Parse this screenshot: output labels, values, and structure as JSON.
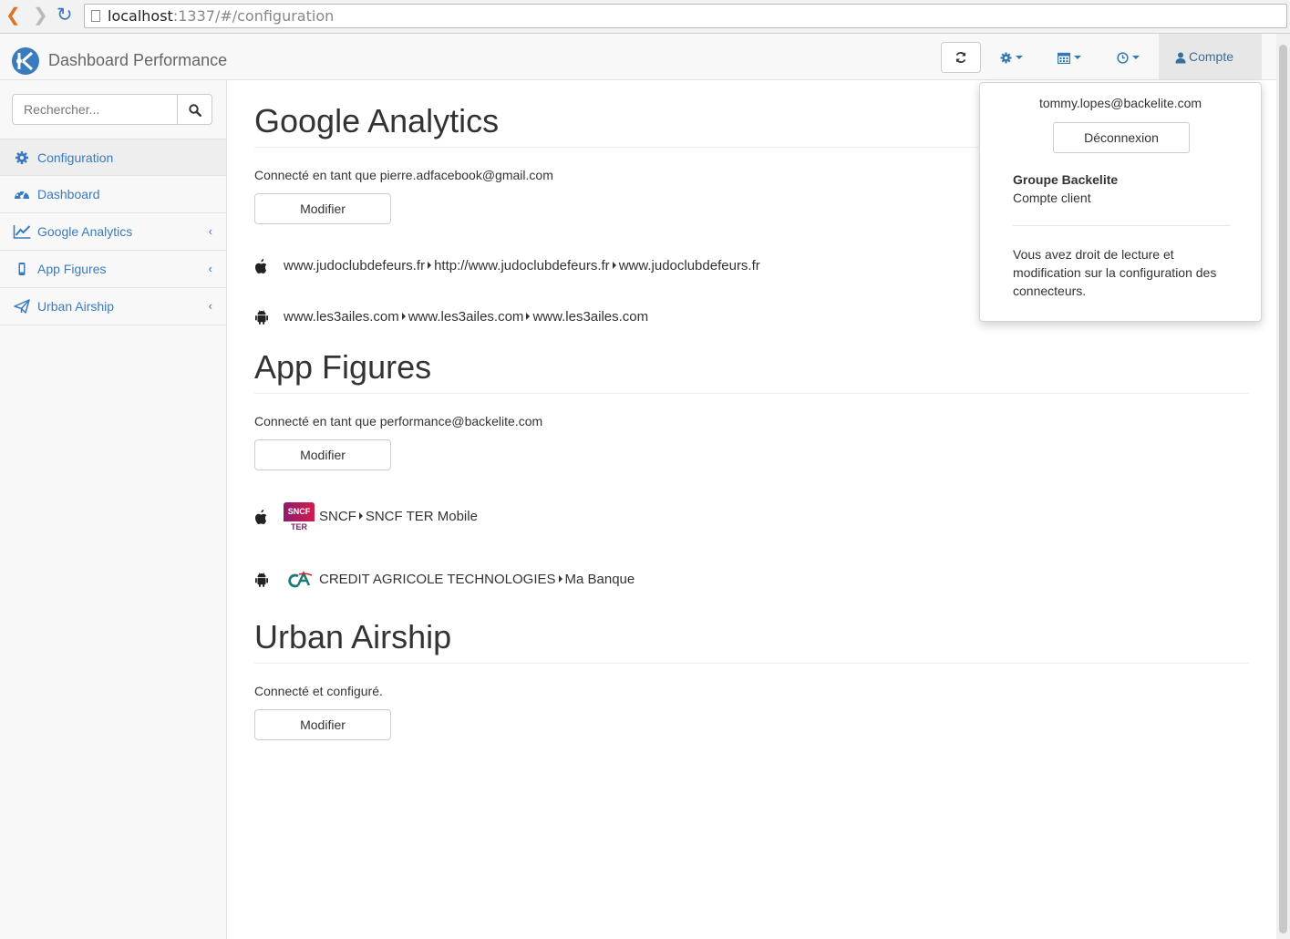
{
  "browser": {
    "url_host": "localhost",
    "url_path": ":1337/#/configuration"
  },
  "navbar": {
    "brand": "Dashboard Performance",
    "account_label": "Compte"
  },
  "sidebar": {
    "search_placeholder": "Rechercher...",
    "items": [
      {
        "label": "Configuration",
        "icon": "gear-icon",
        "active": true
      },
      {
        "label": "Dashboard",
        "icon": "dashboard-icon"
      },
      {
        "label": "Google Analytics",
        "icon": "line-chart-icon"
      },
      {
        "label": "App Figures",
        "icon": "mobile-icon"
      },
      {
        "label": "Urban Airship",
        "icon": "paper-plane-icon"
      }
    ]
  },
  "sections": {
    "google_analytics": {
      "title": "Google Analytics",
      "connected": "Connecté en tant que pierre.adfacebook@gmail.com",
      "button": "Modifier",
      "rows": [
        {
          "os": "apple",
          "parts": [
            "www.judoclubdefeurs.fr",
            "http://www.judoclubdefeurs.fr",
            "www.judoclubdefeurs.fr"
          ]
        },
        {
          "os": "android",
          "parts": [
            "www.les3ailes.com",
            "www.les3ailes.com",
            "www.les3ailes.com"
          ]
        }
      ]
    },
    "app_figures": {
      "title": "App Figures",
      "connected": "Connecté en tant que performance@backelite.com",
      "button": "Modifier",
      "rows": [
        {
          "os": "apple",
          "logo_top": "SNCF",
          "logo_bottom": "TER",
          "parts": [
            "SNCF",
            "SNCF TER Mobile"
          ]
        },
        {
          "os": "android",
          "logo": "CA",
          "parts": [
            "CREDIT AGRICOLE TECHNOLOGIES",
            "Ma Banque"
          ]
        }
      ]
    },
    "urban_airship": {
      "title": "Urban Airship",
      "connected": "Connecté et configuré.",
      "button": "Modifier"
    }
  },
  "account_dropdown": {
    "email": "tommy.lopes@backelite.com",
    "logout": "Déconnexion",
    "group": "Groupe Backelite",
    "role": "Compte client",
    "description": "Vous avez droit de lecture et modification sur la configuration des connecteurs."
  },
  "colors": {
    "link": "#3a7bbf",
    "sncf_logo": "#b3175d",
    "ca_logo": "#1e7b74"
  }
}
